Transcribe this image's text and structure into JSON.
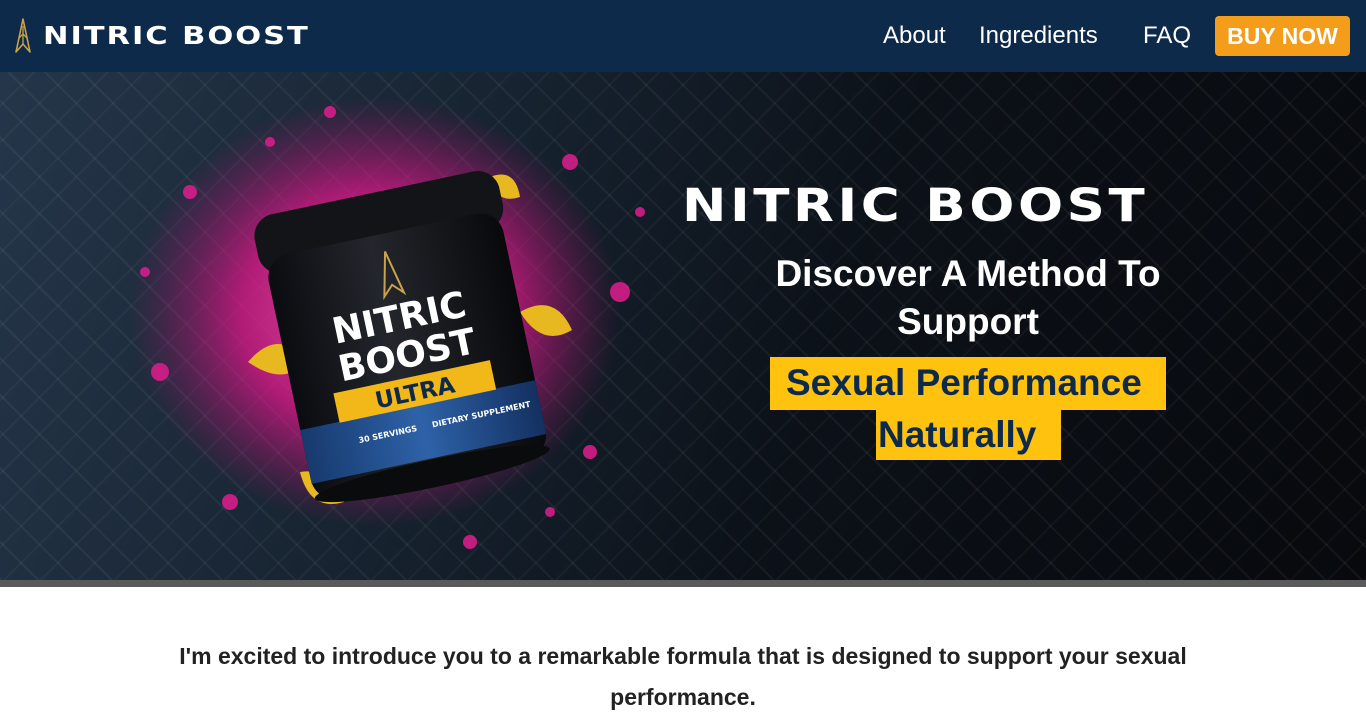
{
  "brand": {
    "name": "NITRIC BOOST",
    "logo_icon": "arrowhead-logo-icon",
    "icon_color": "#c9a24a"
  },
  "nav": {
    "links": [
      "About",
      "Ingredients",
      "FAQ"
    ],
    "buy_label": "BUY NOW",
    "background": "#0d2a4a",
    "buy_color": "#f49d1a"
  },
  "hero": {
    "title": "NITRIC BOOST",
    "subtitle": "Discover A Method To Support",
    "highlight_line1": "Sexual Performance",
    "highlight_line2": "Naturally",
    "highlight_color": "#ffc20e",
    "product": {
      "line1": "NITRIC",
      "line2": "BOOST",
      "badge": "ULTRA",
      "servings": "30 SERVINGS",
      "tag": "DIETARY SUPPLEMENT"
    }
  },
  "intro": {
    "text": "I'm excited to introduce you to a remarkable formula that is designed to support your sexual performance."
  }
}
